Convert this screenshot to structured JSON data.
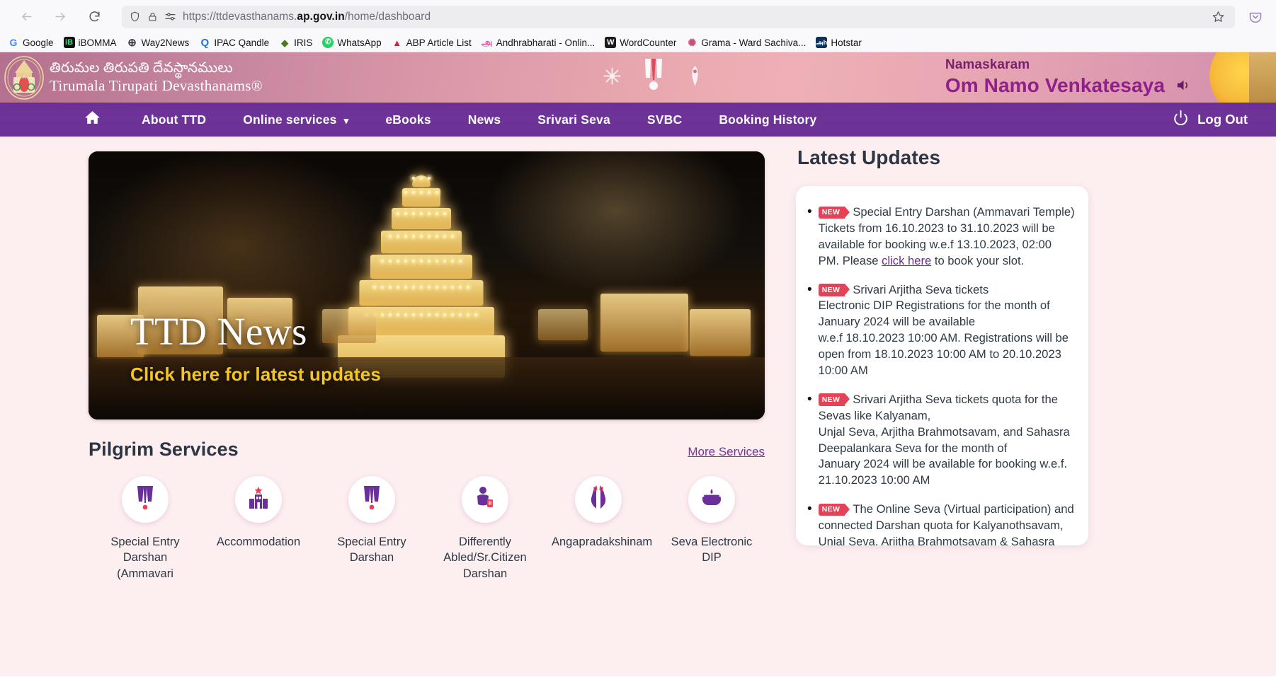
{
  "browser": {
    "url_prefix": "https://ttdevasthanams.",
    "url_domain": "ap.gov.in",
    "url_path": "/home/dashboard",
    "bookmarks": [
      {
        "label": "Google",
        "icon": "google-icon",
        "glyph": "G",
        "fg": "#4285f4",
        "bg": "transparent"
      },
      {
        "label": "iBOMMA",
        "icon": "ibomma-icon",
        "glyph": "iB",
        "fg": "#3ddc84",
        "bg": "#111111"
      },
      {
        "label": "Way2News",
        "icon": "way2news-icon",
        "glyph": "⊕",
        "fg": "#3c3c46",
        "bg": "transparent"
      },
      {
        "label": "IPAC Qandle",
        "icon": "qandle-icon",
        "glyph": "Q",
        "fg": "#1a73e8",
        "bg": "transparent"
      },
      {
        "label": "IRIS",
        "icon": "iris-icon",
        "glyph": "◆",
        "fg": "#4c7a1e",
        "bg": "transparent"
      },
      {
        "label": "WhatsApp",
        "icon": "whatsapp-icon",
        "glyph": "✆",
        "fg": "#ffffff",
        "bg": "#25d366"
      },
      {
        "label": "ABP Article List",
        "icon": "abp-icon",
        "glyph": "▲",
        "fg": "#d32030",
        "bg": "transparent"
      },
      {
        "label": "Andhrabharati - Onlin...",
        "icon": "andhrabharati-icon",
        "glyph": "அ",
        "fg": "#e0559a",
        "bg": "transparent"
      },
      {
        "label": "WordCounter",
        "icon": "wordcounter-icon",
        "glyph": "W",
        "fg": "#ffffff",
        "bg": "#1a1a1a"
      },
      {
        "label": "Grama - Ward Sachiva...",
        "icon": "grama-icon",
        "glyph": "✺",
        "fg": "#c94f7c",
        "bg": "transparent"
      },
      {
        "label": "Hotstar",
        "icon": "hotstar-icon",
        "glyph": "அh",
        "fg": "#ffffff",
        "bg": "#10305c"
      }
    ]
  },
  "site_header": {
    "title_telugu": "తిరుమల తిరుపతి దేవస్థానములు",
    "title_english": "Tirumala Tirupati Devasthanams®",
    "greeting": "Namaskaram",
    "greeting_main": "Om Namo Venkatesaya"
  },
  "nav": {
    "items": [
      {
        "label": "",
        "icon": "home-icon",
        "has_caret": false
      },
      {
        "label": "About TTD",
        "icon": "",
        "has_caret": false
      },
      {
        "label": "Online services",
        "icon": "",
        "has_caret": true
      },
      {
        "label": "eBooks",
        "icon": "",
        "has_caret": false
      },
      {
        "label": "News",
        "icon": "",
        "has_caret": false
      },
      {
        "label": "Srivari Seva",
        "icon": "",
        "has_caret": false
      },
      {
        "label": "SVBC",
        "icon": "",
        "has_caret": false
      },
      {
        "label": "Booking History",
        "icon": "",
        "has_caret": false
      }
    ],
    "logout_label": "Log Out"
  },
  "hero": {
    "title": "TTD News",
    "subtitle": "Click here for latest updates"
  },
  "pilgrim_services": {
    "title": "Pilgrim Services",
    "more_label": "More Services",
    "items": [
      {
        "label": "Special Entry Darshan (Ammavari",
        "icon": "namam-icon"
      },
      {
        "label": "Accommodation",
        "icon": "building-icon"
      },
      {
        "label": "Special Entry Darshan",
        "icon": "namam-icon"
      },
      {
        "label": "Differently Abled/Sr.Citizen Darshan",
        "icon": "person-accessibility-icon"
      },
      {
        "label": "Angapradakshinam",
        "icon": "praying-hands-icon"
      },
      {
        "label": "Seva Electronic DIP",
        "icon": "dip-lamp-icon"
      }
    ]
  },
  "latest_updates": {
    "title": "Latest Updates",
    "badge": "NEW",
    "items": [
      {
        "pre_link": "Special Entry Darshan (Ammavari Temple) Tickets from 16.10.2023 to 31.10.2023 will be available for booking w.e.f 13.10.2023, 02:00 PM. Please ",
        "link": "click here",
        "post_link": " to book your slot."
      },
      {
        "pre_link": "Srivari Arjitha Seva tickets\nElectronic DIP Registrations for the month of January 2024 will be available\nw.e.f  18.10.2023 10:00 AM. Registrations will be open from 18.10.2023 10:00 AM to 20.10.2023 10:00 AM",
        "link": "",
        "post_link": ""
      },
      {
        "pre_link": "Srivari Arjitha Seva tickets quota for the Sevas like Kalyanam,\nUnjal Seva, Arjitha Brahmotsavam, and Sahasra Deepalankara Seva for the month of\nJanuary  2024 will be available for booking w.e.f. 21.10.2023 10:00 AM",
        "link": "",
        "post_link": ""
      },
      {
        "pre_link": "The Online Seva (Virtual participation) and connected Darshan quota for Kalyanothsavam, Unjal Seva, Arjitha Brahmotsavam & Sahasra Deepalankara Sevas of Srivari Temple, Tirumala",
        "link": "",
        "post_link": ""
      }
    ]
  },
  "colors": {
    "nav_purple": "#6c3194",
    "page_bg": "#fdeef0",
    "accent_purple": "#6f2b91",
    "badge_red": "#e34257",
    "hero_gold": "#f3c623"
  }
}
